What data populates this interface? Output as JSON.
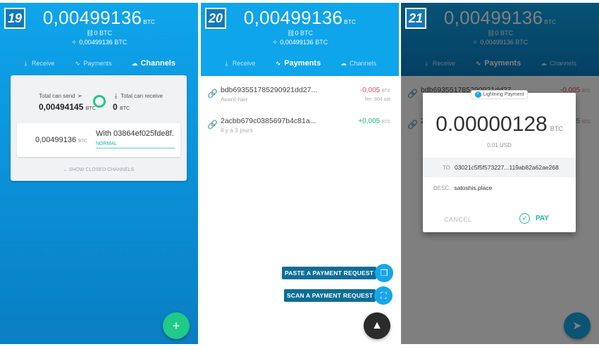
{
  "steps": [
    "19",
    "20",
    "21"
  ],
  "balance": {
    "value": "0,00499136",
    "unit": "BTC",
    "onchain_value": "0",
    "onchain_unit": "BTC",
    "lightning_value": "0,00499136",
    "lightning_unit": "BTC"
  },
  "tabs": {
    "receive": "Receive",
    "payments": "Payments",
    "channels": "Channels"
  },
  "channels": {
    "total_send_label": "Total can send",
    "total_send_value": "0,00494145",
    "total_send_unit": "BTC",
    "total_receive_label": "Total can receive",
    "total_receive_value": "0",
    "total_receive_unit": "BTC",
    "channel_amount": "0,00499136",
    "channel_unit": "BTC",
    "channel_with": "With 03864ef025fde8f...",
    "channel_state": "NORMAL",
    "show_closed": "SHOW CLOSED CHANNELS"
  },
  "payments": [
    {
      "hash": "bdb693551785290921dd27...",
      "when": "Avant-hier",
      "amount": "-0,005",
      "unit": "BTC",
      "fee_label": "fee:",
      "fee": "864",
      "fee_unit": "sat"
    },
    {
      "hash": "2acbb679c0385697b4c81a...",
      "when": "Il y a 3 jours",
      "amount": "+0,005",
      "unit": "BTC"
    }
  ],
  "actions": {
    "paste": "PASTE A PAYMENT REQUEST",
    "scan": "SCAN A PAYMENT REQUEST"
  },
  "dialog": {
    "badge": "Lightning Payment",
    "amount": "0.00000128",
    "unit": "BTC",
    "fiat": "0,01 USD",
    "to_label": "TO",
    "to_value": "03021c5f5f573227...119ab82a62ae268",
    "desc_label": "DESC.",
    "desc_value": "satoshis.place",
    "cancel": "CANCEL",
    "pay": "PAY"
  },
  "icons": {
    "add": "+",
    "send": "➤"
  }
}
